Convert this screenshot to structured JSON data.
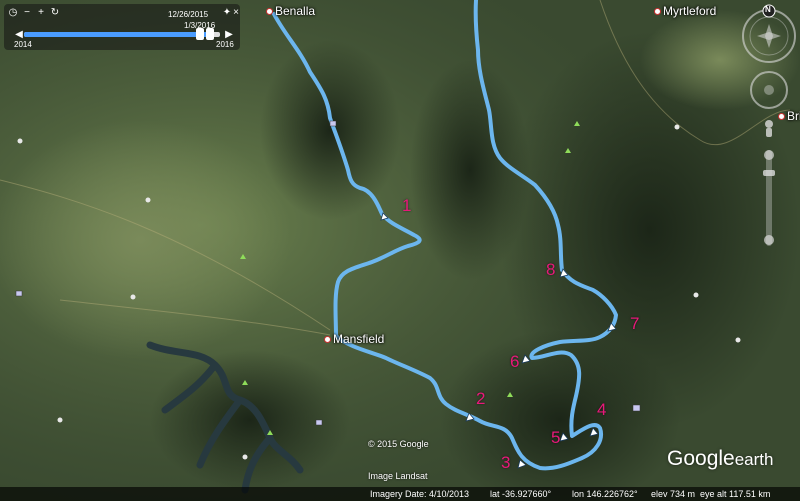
{
  "timeline": {
    "start_date": "12/26/2015",
    "end_date": "1/3/2016",
    "range_start": "2014",
    "range_end": "2016",
    "position_fraction": 0.97
  },
  "places": {
    "benalla": "Benalla",
    "myrtleford": "Myrtleford",
    "mansfield": "Mansfield",
    "bright": "Bri"
  },
  "waypoints": [
    "1",
    "2",
    "3",
    "4",
    "5",
    "6",
    "7",
    "8"
  ],
  "credits": {
    "copyright": "© 2015 Google",
    "image": "Image Landsat"
  },
  "status": {
    "imagery_date": "Imagery Date: 4/10/2013",
    "lat": "lat  -36.927660°",
    "lon": "lon  146.226762°",
    "elev": "elev   734 m",
    "eye_alt": "eye alt 117.51 km"
  },
  "logo": {
    "google": "Google",
    "earth": "earth"
  },
  "nav": {
    "north": "N"
  },
  "colors": {
    "route": "#6cb6ee",
    "waypoint_label": "#e8197a",
    "terrain_dark": "#263320",
    "terrain_light": "#5f7447",
    "water": "#27393f"
  }
}
